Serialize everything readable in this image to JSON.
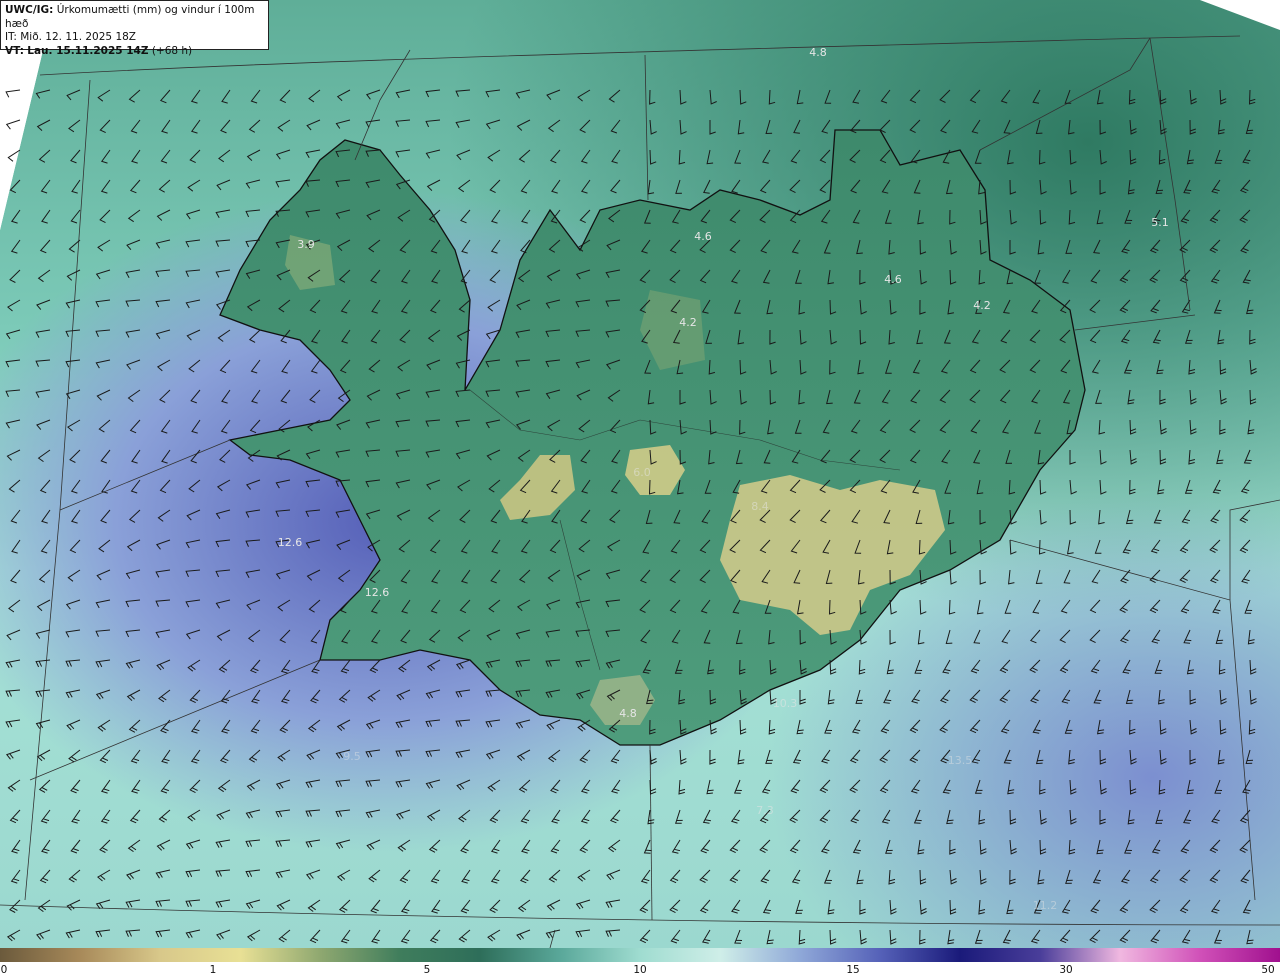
{
  "header": {
    "model": "UWC/IG:",
    "product": "Úrkomumætti (mm) og vindur í 100m hæð",
    "init_time": "IT: Mið. 12. 11. 2025 18Z",
    "valid_prefix": "VT:",
    "valid_time": "Lau. 15.11.2025 14Z",
    "lead": "(+68 h)"
  },
  "map": {
    "region": "Iceland",
    "background": "#6fb9a8",
    "coast_color": "#111111",
    "grid_color": "#333333",
    "barb_color": "#1a1a1a",
    "value_labels": [
      {
        "text": "4.8",
        "tone": "light"
      },
      {
        "text": "5.1",
        "tone": "light"
      },
      {
        "text": "3.9",
        "tone": "light"
      },
      {
        "text": "4.6",
        "tone": "light"
      },
      {
        "text": "4.6",
        "tone": "light"
      },
      {
        "text": "4.2",
        "tone": "light"
      },
      {
        "text": "4.2",
        "tone": "light"
      },
      {
        "text": "12.6",
        "tone": "light"
      },
      {
        "text": "12.6",
        "tone": "light"
      },
      {
        "text": "4.8",
        "tone": "light"
      },
      {
        "text": "10.3",
        "tone": "faint"
      },
      {
        "text": "7.3",
        "tone": "faint"
      },
      {
        "text": "9.5",
        "tone": "faint"
      },
      {
        "text": "13.5",
        "tone": "faint"
      },
      {
        "text": "11.2",
        "tone": "faint"
      },
      {
        "text": "8.4",
        "tone": "faint"
      },
      {
        "text": "6.0",
        "tone": "faint"
      }
    ]
  },
  "colorbar": {
    "ticks": [
      "0",
      "1",
      "5",
      "10",
      "15",
      "30",
      "50"
    ],
    "colors": [
      "#6b5a3c",
      "#a88a5a",
      "#d8c88a",
      "#e8e095",
      "#8fa870",
      "#3f7d5c",
      "#2e6e5a",
      "#5aa89a",
      "#9fdcd0",
      "#cfeee8",
      "#8fa8d8",
      "#5561b8",
      "#1a1a7a",
      "#4a3e9a",
      "#f0b8e0",
      "#d050b8",
      "#a0108e"
    ]
  }
}
